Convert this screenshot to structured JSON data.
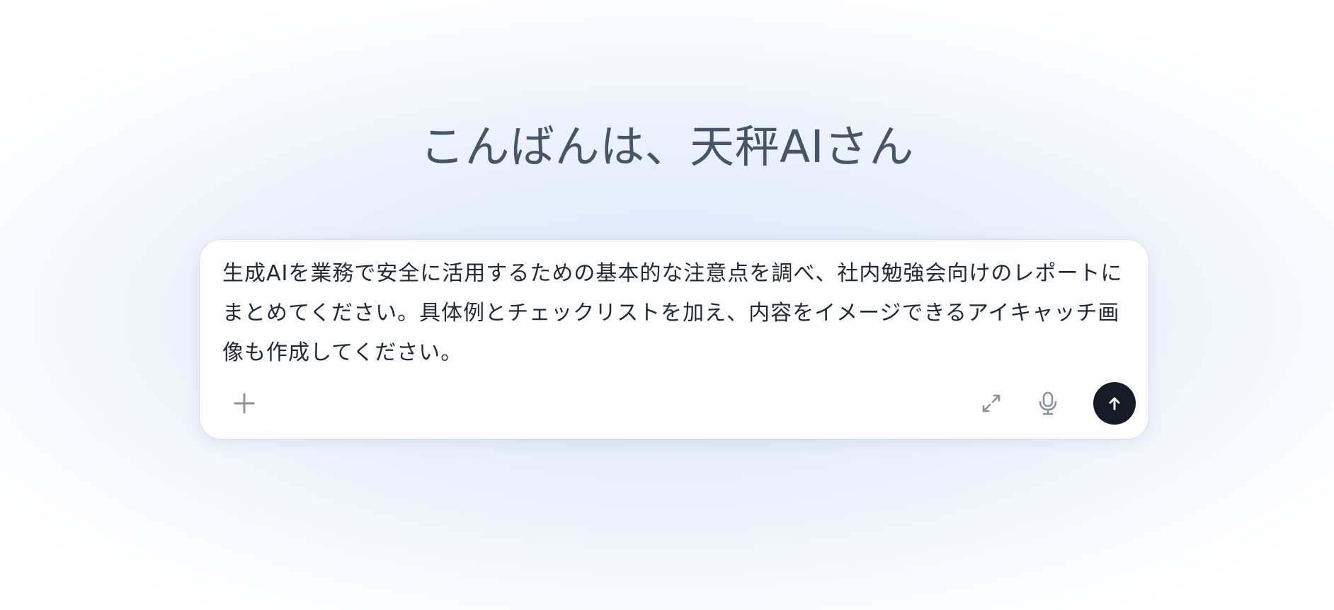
{
  "greeting": {
    "text": "こんばんは、天秤AIさん"
  },
  "composer": {
    "prompt_value": "生成AIを業務で安全に活用するための基本的な注意点を調べ、社内勉強会向けのレポートにまとめてください。具体例とチェックリストを加え、内容をイメージできるアイキャッチ画像も作成してください。",
    "buttons": {
      "attach_icon": "plus-icon",
      "expand_icon": "expand-icon",
      "mic_icon": "microphone-icon",
      "send_icon": "arrow-up-icon"
    }
  },
  "colors": {
    "greeting_text": "#475569",
    "prompt_text": "#1f2937",
    "icon_gray": "#8a929c",
    "send_button": "#151b26",
    "background_tint": "#dce8fb"
  }
}
